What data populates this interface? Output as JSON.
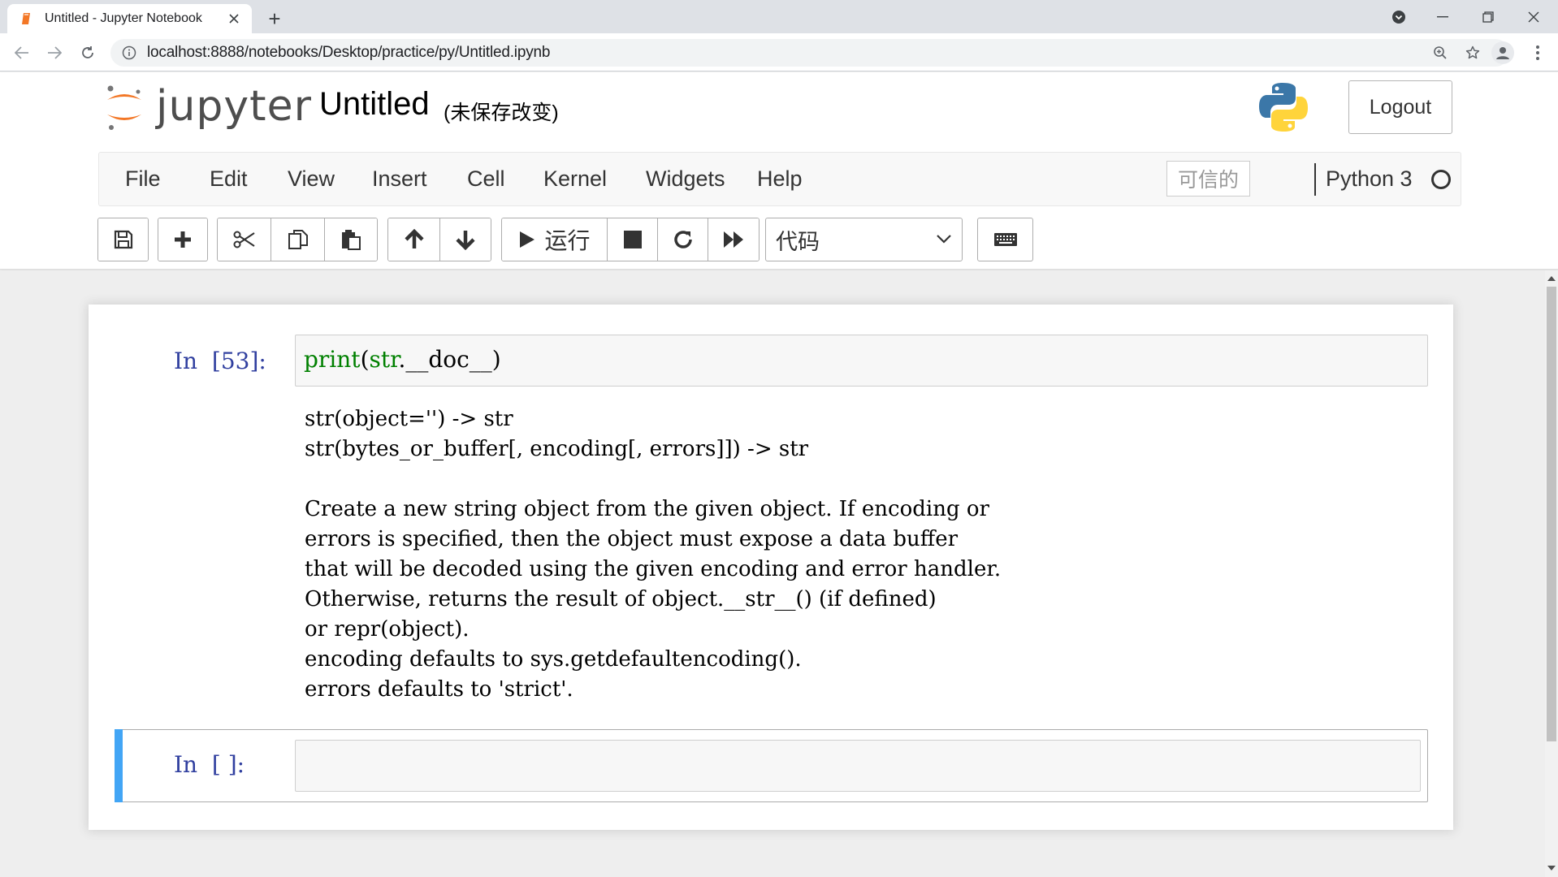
{
  "browser": {
    "tab_title": "Untitled - Jupyter Notebook",
    "new_tab": "+",
    "url": "localhost:8888/notebooks/Desktop/practice/py/Untitled.ipynb"
  },
  "header": {
    "logo_text": "jupyter",
    "notebook_title": "Untitled",
    "save_status": "(未保存改变)",
    "logout_label": "Logout"
  },
  "menubar": {
    "items": [
      "File",
      "Edit",
      "View",
      "Insert",
      "Cell",
      "Kernel",
      "Widgets",
      "Help"
    ],
    "trusted_label": "可信的",
    "kernel_name": "Python 3"
  },
  "toolbar": {
    "run_label": "运行",
    "cell_type": "代码"
  },
  "cells": [
    {
      "prompt": "In  [53]:",
      "code_builtin": "print",
      "code_paren_open": "(",
      "code_str": "str",
      "code_rest": ".__doc__)",
      "output": [
        "str(object='') -> str",
        "str(bytes_or_buffer[, encoding[, errors]]) -> str",
        "",
        "Create a new string object from the given object. If encoding or",
        "errors is specified, then the object must expose a data buffer",
        "that will be decoded using the given encoding and error handler.",
        "Otherwise, returns the result of object.__str__() (if defined)",
        "or repr(object).",
        "encoding defaults to sys.getdefaultencoding().",
        "errors defaults to 'strict'."
      ]
    },
    {
      "prompt": "In  [ ]:"
    }
  ],
  "colors": {
    "prompt_blue": "#303f9f",
    "selected_cell_bar": "#42a5f5",
    "builtin_green": "#008000"
  }
}
